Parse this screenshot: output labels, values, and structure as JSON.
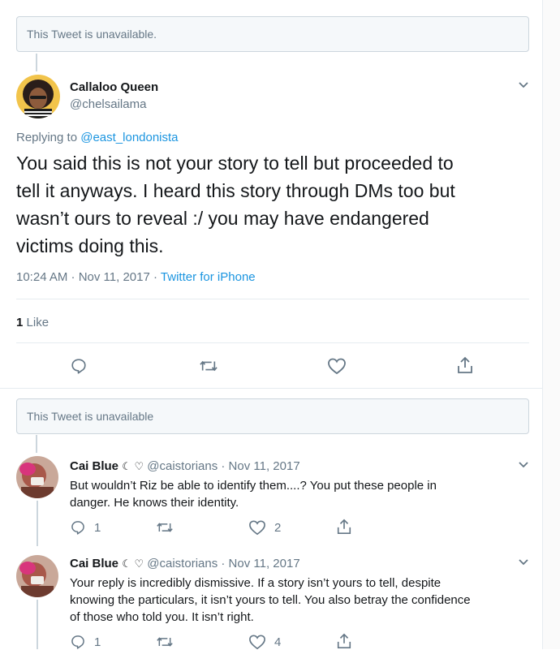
{
  "unavailable_top": "This Tweet is unavailable.",
  "main_tweet": {
    "name": "Callaloo Queen",
    "handle": "@chelsailama",
    "replying_prefix": "Replying to",
    "replying_to": "@east_londonista",
    "text_lines": [
      "You said this is not your story to tell but proceeded to",
      "tell it anyways. I heard this story through DMs too but",
      "wasn’t ours to reveal :/ you may have endangered",
      "victims doing this."
    ],
    "timestamp": "10:24 AM · Nov 11, 2017 ·",
    "source": "Twitter for iPhone",
    "like_count": "1",
    "like_label": "Like"
  },
  "unavailable_mid": "This Tweet is unavailable",
  "replies": [
    {
      "name": "Cai Blue",
      "emoji": "☾ ♡",
      "handle": "@caistorians",
      "date": "· Nov 11, 2017",
      "text_lines": [
        "But wouldn’t Riz be able to identify them....?  You put these people in",
        "danger. He knows their identity."
      ],
      "reply_count": "1",
      "like_count": "2"
    },
    {
      "name": "Cai Blue",
      "emoji": "☾ ♡",
      "handle": "@caistorians",
      "date": "· Nov 11, 2017",
      "text_lines": [
        "Your reply is incredibly dismissive. If a story isn’t yours to tell, despite",
        "knowing the particulars, it isn’t yours to tell. You also betray the confidence",
        "of those who told you. It isn’t right."
      ],
      "reply_count": "1",
      "like_count": "4"
    }
  ],
  "icons": {
    "reply": "reply-icon",
    "retweet": "retweet-icon",
    "like": "heart-icon",
    "share": "share-icon",
    "caret": "chevron-down-icon"
  },
  "colors": {
    "link": "#1b95e0",
    "muted": "#657786",
    "border": "#e6ecf0"
  }
}
